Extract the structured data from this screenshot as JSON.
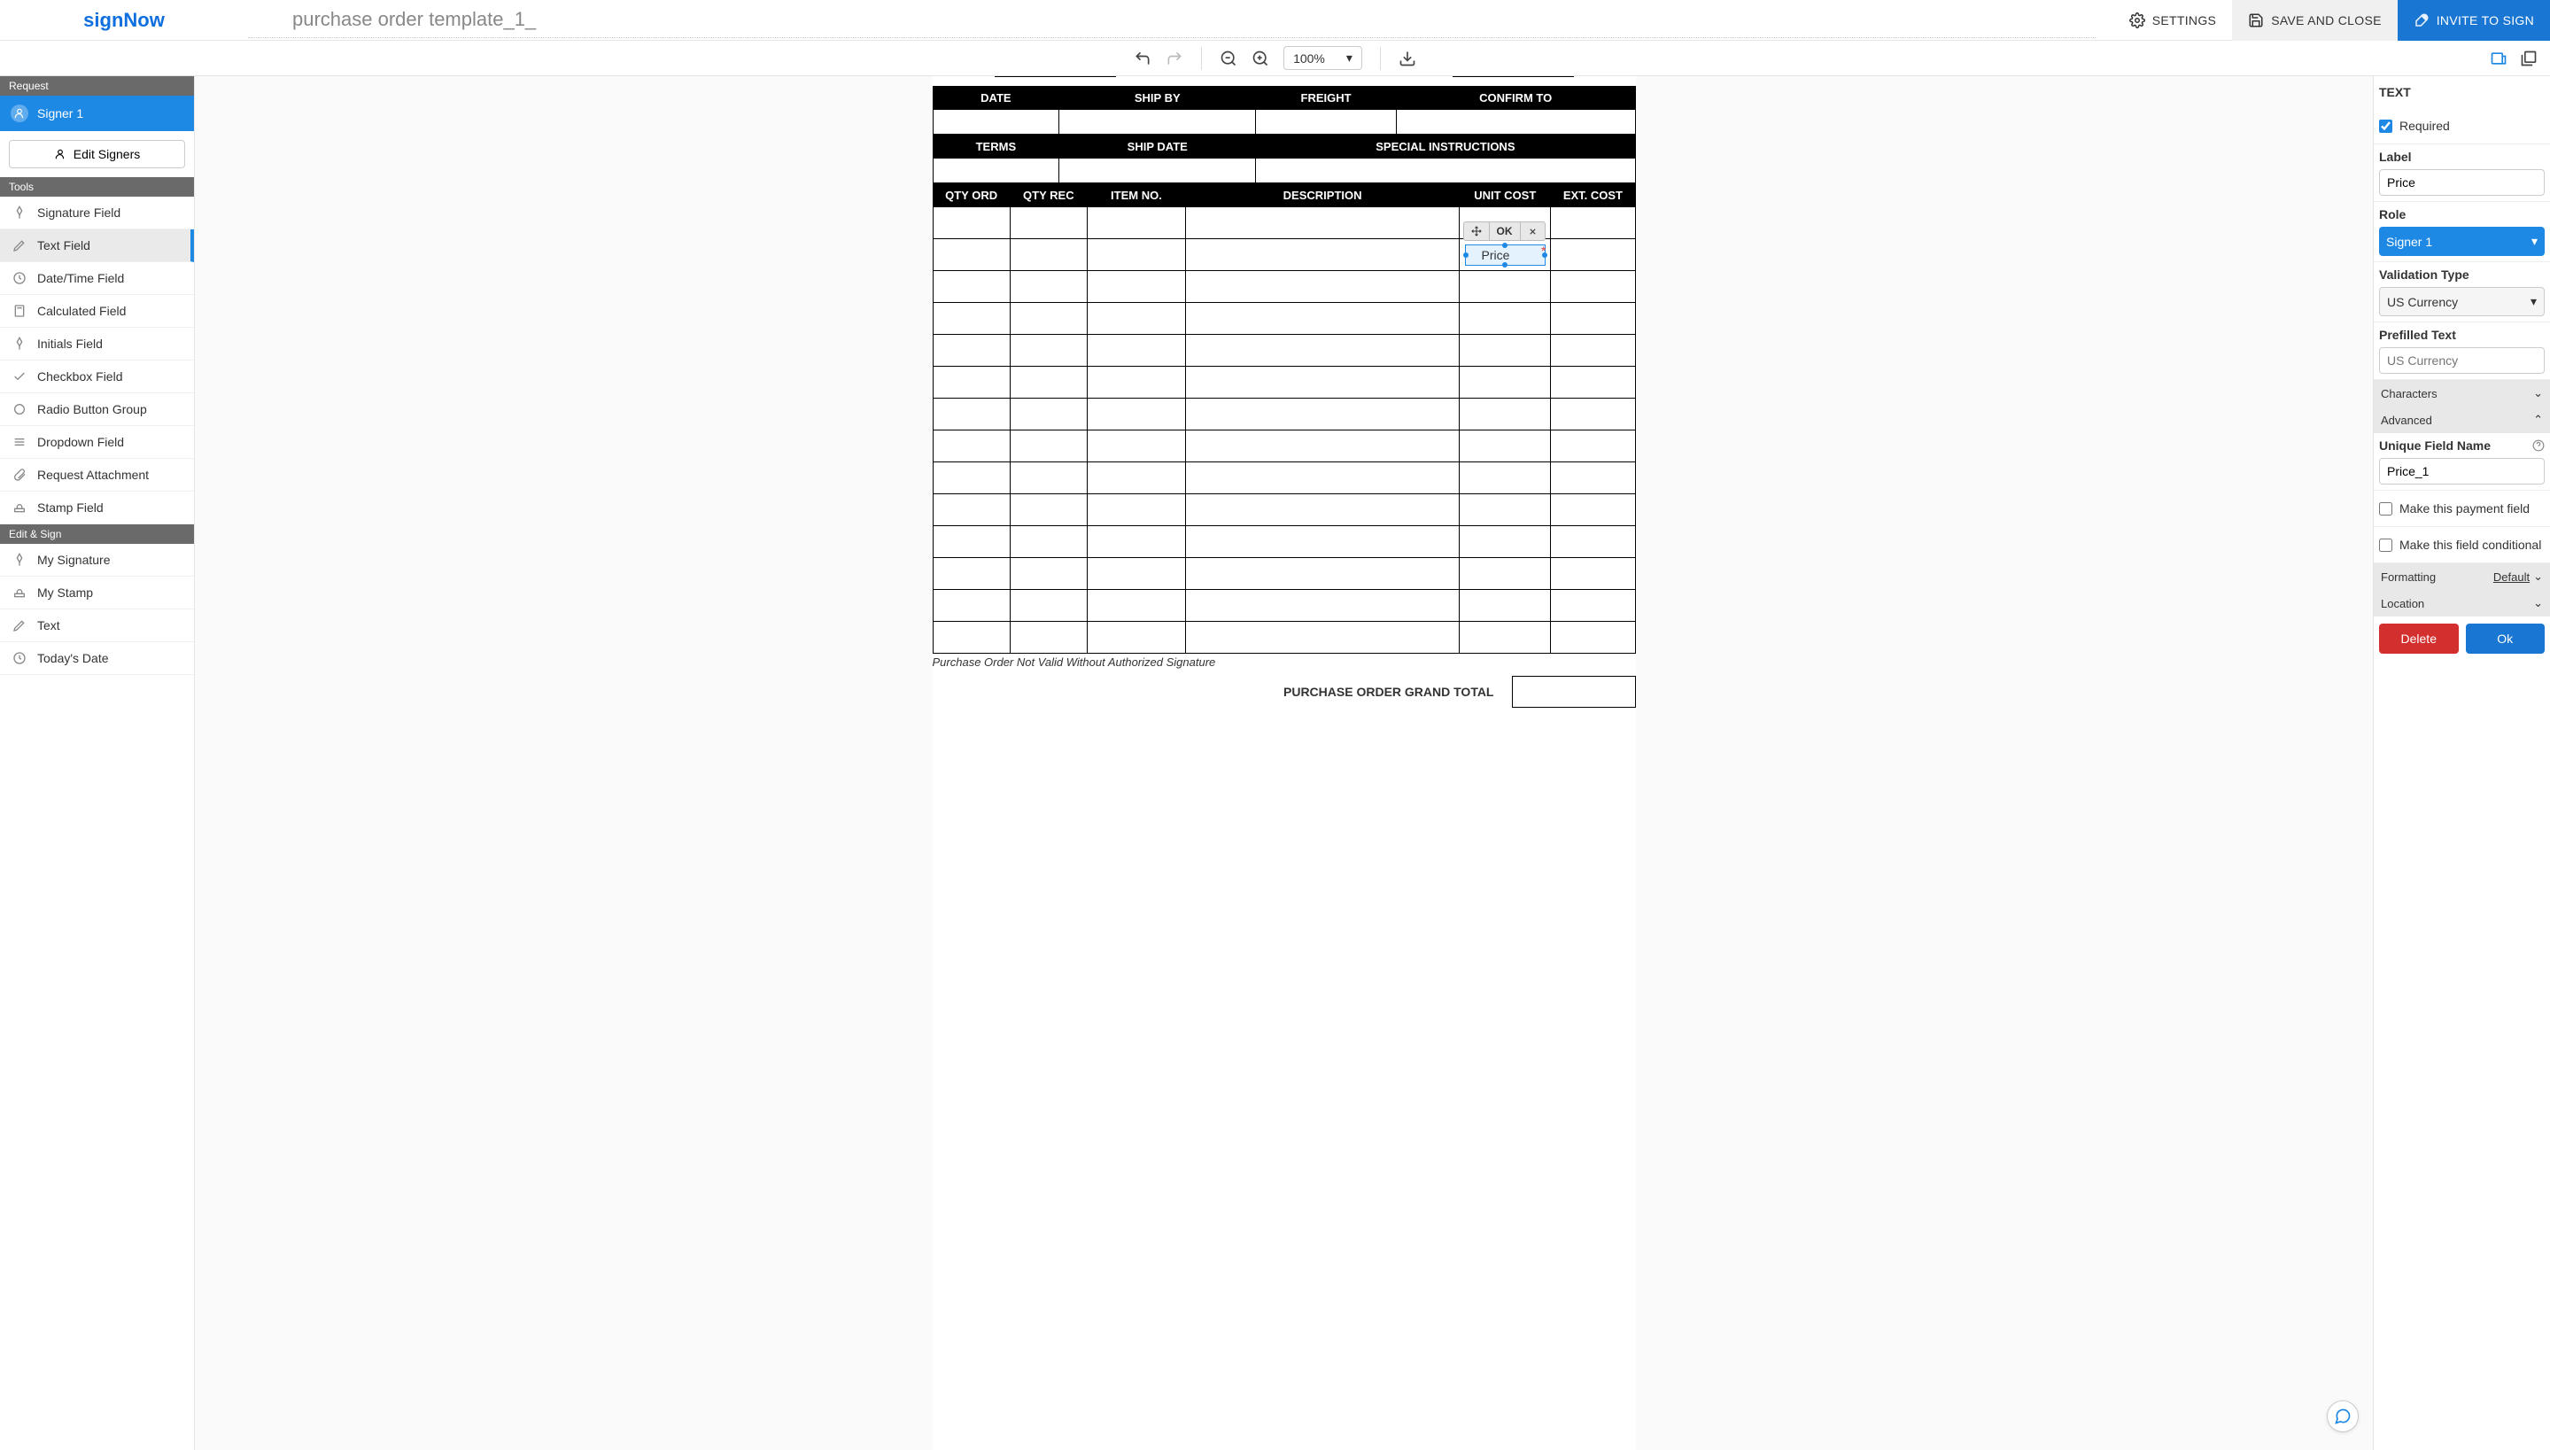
{
  "header": {
    "logo": "signNow",
    "doc_title": "purchase order template_1_",
    "settings": "SETTINGS",
    "save_close": "SAVE AND CLOSE",
    "invite": "INVITE TO SIGN"
  },
  "toolbar": {
    "zoom": "100%"
  },
  "sidebar": {
    "request_header": "Request",
    "signer1": "Signer 1",
    "edit_signers": "Edit Signers",
    "tools_header": "Tools",
    "tools": [
      "Signature Field",
      "Text Field",
      "Date/Time Field",
      "Calculated Field",
      "Initials Field",
      "Checkbox Field",
      "Radio Button Group",
      "Dropdown Field",
      "Request Attachment",
      "Stamp Field"
    ],
    "edit_sign_header": "Edit & Sign",
    "edit_sign_tools": [
      "My Signature",
      "My Stamp",
      "Text",
      "Today's Date"
    ]
  },
  "document": {
    "hdr1": [
      "DATE",
      "SHIP BY",
      "FREIGHT",
      "CONFIRM TO"
    ],
    "hdr2": [
      "TERMS",
      "SHIP DATE",
      "SPECIAL INSTRUCTIONS"
    ],
    "hdr3": [
      "QTY ORD",
      "QTY REC",
      "ITEM NO.",
      "DESCRIPTION",
      "UNIT COST",
      "EXT. COST"
    ],
    "footnote": "Purchase Order Not Valid Without Authorized Signature",
    "grand_total": "PURCHASE ORDER GRAND TOTAL"
  },
  "placed_field": {
    "ok": "OK",
    "label": "Price"
  },
  "panel": {
    "title": "TEXT",
    "required": "Required",
    "label_lbl": "Label",
    "label_val": "Price",
    "role_lbl": "Role",
    "role_val": "Signer 1",
    "valtype_lbl": "Validation Type",
    "valtype_val": "US Currency",
    "prefill_lbl": "Prefilled Text",
    "prefill_placeholder": "US Currency",
    "characters": "Characters",
    "advanced": "Advanced",
    "unique_lbl": "Unique Field Name",
    "unique_val": "Price_1",
    "payment": "Make this payment field",
    "conditional": "Make this field conditional",
    "formatting": "Formatting",
    "formatting_default": "Default",
    "location": "Location",
    "delete": "Delete",
    "ok": "Ok"
  }
}
